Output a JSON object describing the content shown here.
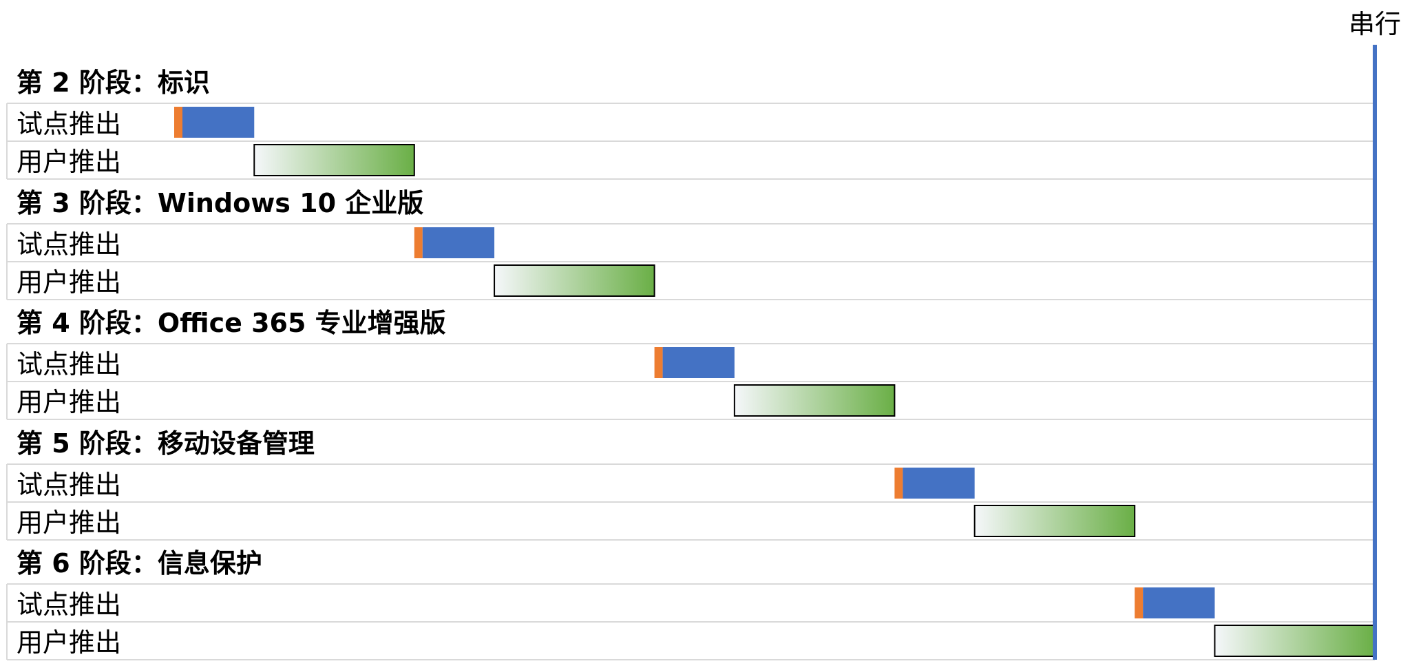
{
  "chart_data": {
    "type": "gantt",
    "marker": {
      "label": "串行",
      "color": "#4472C4"
    },
    "colors": {
      "pilot_start": "#ED7D31",
      "pilot": "#4472C4",
      "rollout_start": "#F5F7FA",
      "rollout_end": "#6AAF46",
      "grid": "#D9D9D9",
      "rollout_border": "#000000"
    },
    "x_range": [
      0,
      15
    ],
    "phases": [
      {
        "title": "第 2 阶段：标识",
        "tasks": [
          {
            "label": "试点推出",
            "kind": "pilot",
            "start": 0,
            "end": 1
          },
          {
            "label": "用户推出",
            "kind": "rollout",
            "start": 1,
            "end": 3
          }
        ]
      },
      {
        "title": "第 3 阶段：Windows 10 企业版",
        "tasks": [
          {
            "label": "试点推出",
            "kind": "pilot",
            "start": 3,
            "end": 4
          },
          {
            "label": "用户推出",
            "kind": "rollout",
            "start": 4,
            "end": 6
          }
        ]
      },
      {
        "title": "第 4 阶段：Office 365 专业增强版",
        "tasks": [
          {
            "label": "试点推出",
            "kind": "pilot",
            "start": 6,
            "end": 7
          },
          {
            "label": "用户推出",
            "kind": "rollout",
            "start": 7,
            "end": 9
          }
        ]
      },
      {
        "title": "第 5 阶段：移动设备管理",
        "tasks": [
          {
            "label": "试点推出",
            "kind": "pilot",
            "start": 9,
            "end": 10
          },
          {
            "label": "用户推出",
            "kind": "rollout",
            "start": 10,
            "end": 12
          }
        ]
      },
      {
        "title": "第 6 阶段：信息保护",
        "tasks": [
          {
            "label": "试点推出",
            "kind": "pilot",
            "start": 12,
            "end": 13
          },
          {
            "label": "用户推出",
            "kind": "rollout",
            "start": 13,
            "end": 15
          }
        ]
      }
    ]
  }
}
